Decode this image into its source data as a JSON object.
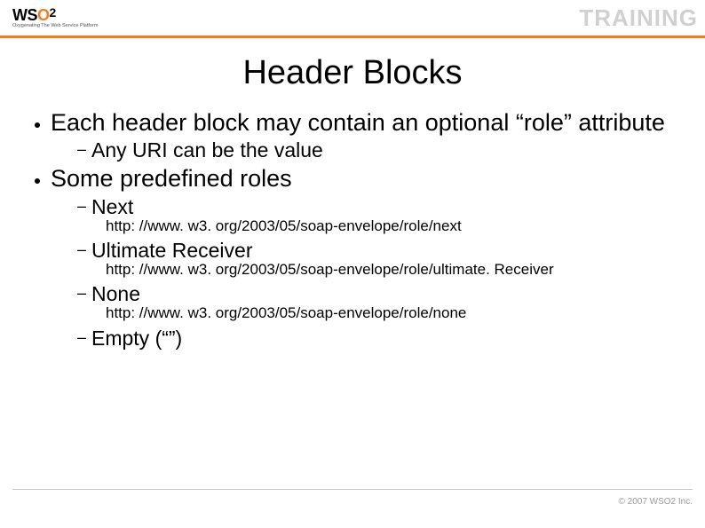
{
  "header": {
    "logo_text": "WSO2",
    "logo_tagline": "Oxygenating The Web Service Platform",
    "training_label": "TRAINING"
  },
  "slide": {
    "title": "Header Blocks",
    "bullets": [
      {
        "text": "Each header block may contain an optional “role” attribute",
        "children": [
          {
            "text": "Any URI can be the value"
          }
        ]
      },
      {
        "text": "Some predefined roles",
        "children": [
          {
            "text": "Next",
            "url": "http: //www. w3. org/2003/05/soap-envelope/role/next"
          },
          {
            "text": "Ultimate Receiver",
            "url": "http: //www. w3. org/2003/05/soap-envelope/role/ultimate. Receiver"
          },
          {
            "text": "None",
            "url": "http: //www. w3. org/2003/05/soap-envelope/role/none"
          },
          {
            "text": "Empty (“”)"
          }
        ]
      }
    ]
  },
  "footer": {
    "copyright": "© 2007 WSO2 Inc."
  }
}
